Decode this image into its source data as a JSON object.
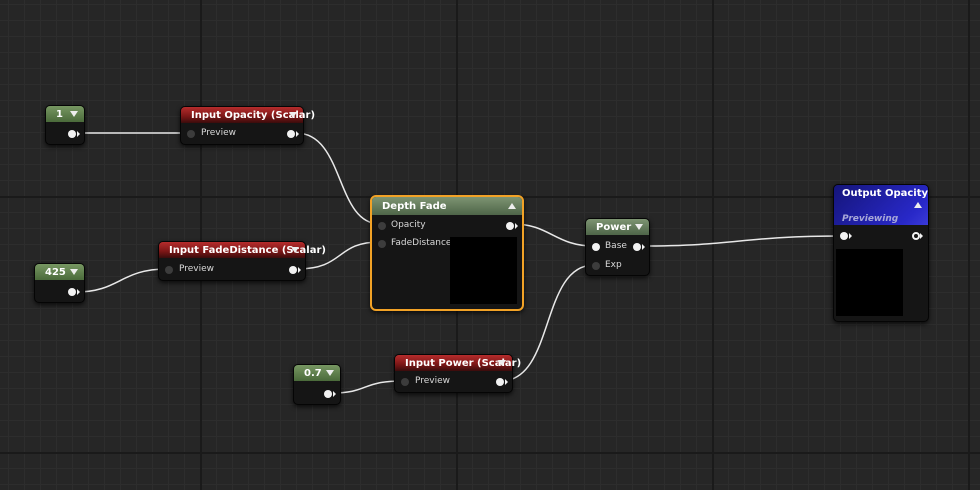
{
  "nodes": {
    "const_one": {
      "value": "1"
    },
    "const_425": {
      "value": "425"
    },
    "const_07": {
      "value": "0.7"
    },
    "input_opacity": {
      "title": "Input Opacity (Scalar)",
      "out_label": "Preview"
    },
    "input_fade_distance": {
      "title": "Input FadeDistance (Scalar)",
      "out_label": "Preview"
    },
    "input_power": {
      "title": "Input Power (Scalar)",
      "out_label": "Preview"
    },
    "depth_fade": {
      "title": "Depth Fade",
      "pins": [
        "Opacity",
        "FadeDistance"
      ]
    },
    "power": {
      "title": "Power",
      "pins": [
        "Base",
        "Exp"
      ]
    },
    "output_opacity": {
      "title": "Output Opacity",
      "subtitle": "Previewing"
    }
  },
  "colors": {
    "wire": "#e8e8e8",
    "selection": "#f2a226",
    "constant_header": "#5d7d4a",
    "input_header": "#9a2020",
    "output_header": "#2424b8"
  }
}
